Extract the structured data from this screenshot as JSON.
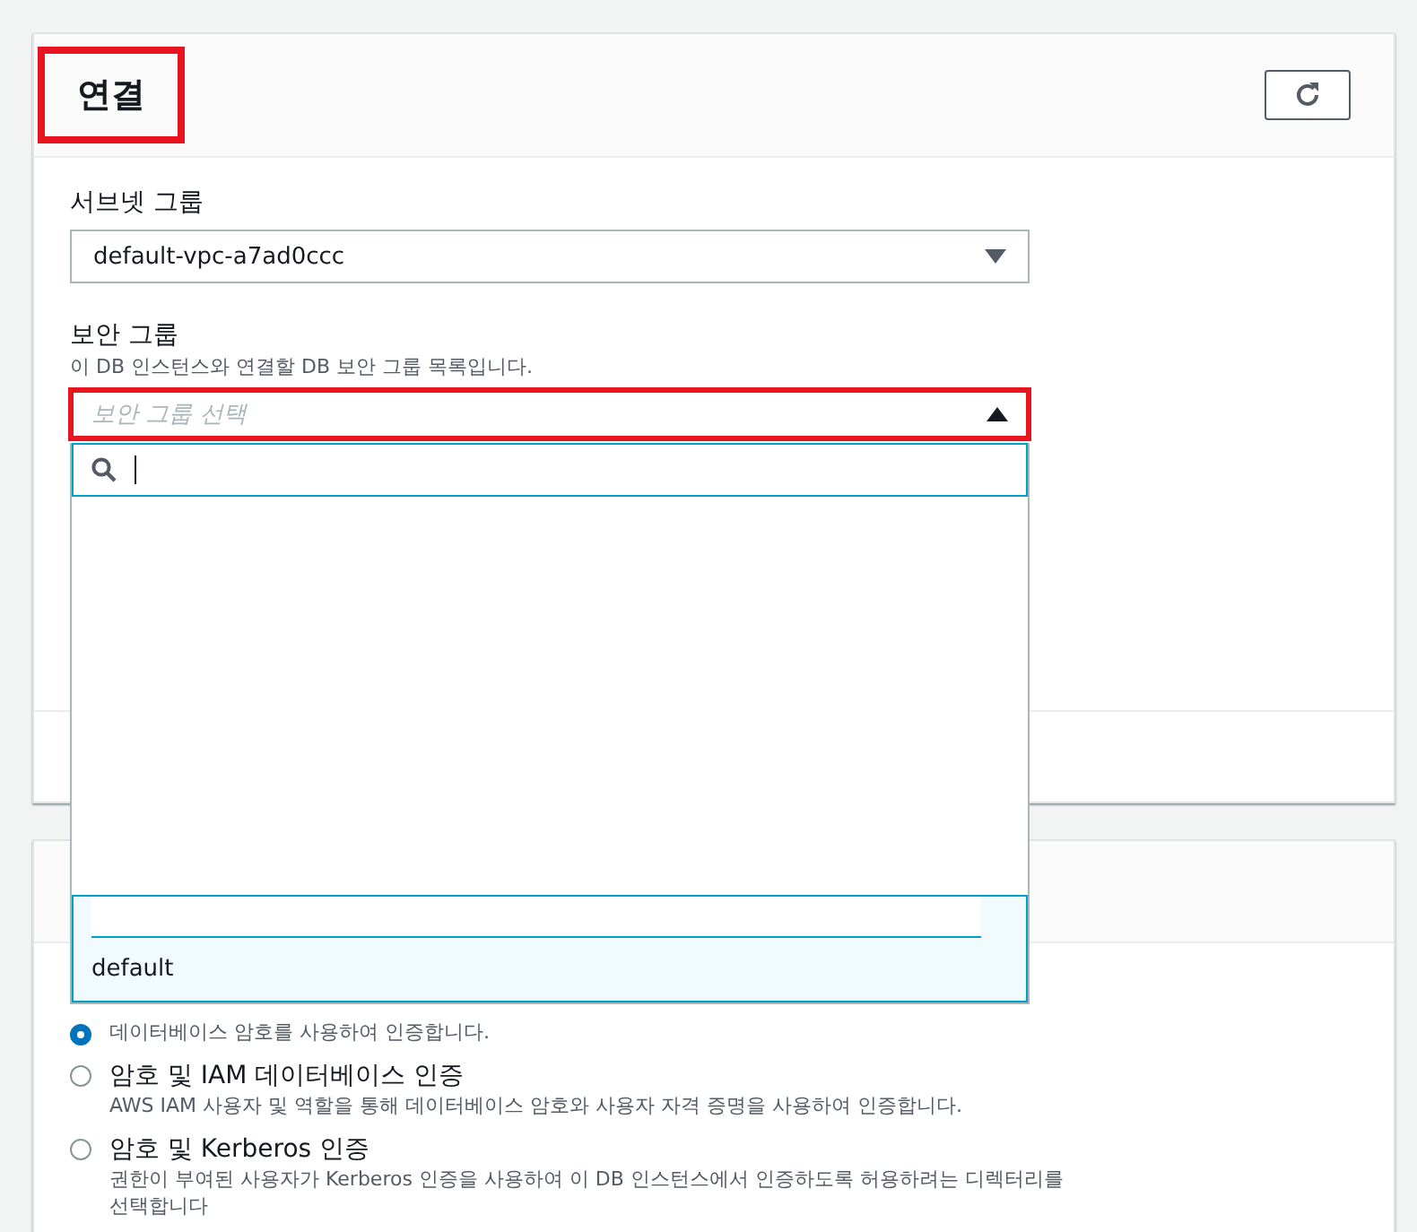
{
  "connection_card": {
    "title": "연결",
    "title_highlighted": true,
    "subnet_group": {
      "label": "서브넷 그룹",
      "value": "default-vpc-a7ad0ccc"
    },
    "security_group": {
      "label": "보안 그룹",
      "description": "이 DB 인스턴스와 연결할 DB 보안 그룹 목록입니다.",
      "placeholder": "보안 그룹 선택",
      "expanded": true,
      "highlighted": true,
      "options": [
        {
          "label": "default",
          "selected": true
        }
      ]
    }
  },
  "auth_card": {
    "options": [
      {
        "description": "데이터베이스 암호를 사용하여 인증합니다.",
        "selected": true
      },
      {
        "title": "암호 및 IAM 데이터베이스 인증",
        "description": "AWS IAM 사용자 및 역할을 통해 데이터베이스 암호와 사용자 자격 증명을 사용하여 인증합니다.",
        "selected": false
      },
      {
        "title": "암호 및 Kerberos 인증",
        "description": "권한이 부여된 사용자가 Kerberos 인증을 사용하여 이 DB 인스턴스에서 인증하도록 허용하려는 디렉터리를 선택합니다",
        "selected": false
      }
    ]
  }
}
